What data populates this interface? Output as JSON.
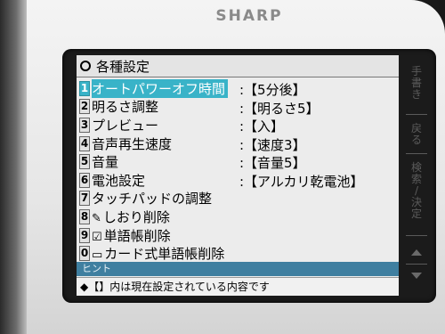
{
  "device": {
    "brand": "SHARP"
  },
  "screen": {
    "title": "各種設定",
    "items": [
      {
        "num": "1",
        "label": "オートパワーオフ時間",
        "value": ":【5分後】",
        "selected": true
      },
      {
        "num": "2",
        "label": "明るさ調整",
        "value": ":【明るさ5】"
      },
      {
        "num": "3",
        "label": "プレビュー",
        "value": ":【入】"
      },
      {
        "num": "4",
        "label": "音声再生速度",
        "value": ":【速度3】"
      },
      {
        "num": "5",
        "label": "音量",
        "value": ":【音量5】"
      },
      {
        "num": "6",
        "label": "電池設定",
        "value": ":【アルカリ乾電池】"
      },
      {
        "num": "7",
        "label": "タッチパッドの調整",
        "value": ""
      },
      {
        "num": "8",
        "icon": "pen-icon",
        "label": "しおり削除",
        "value": ""
      },
      {
        "num": "9",
        "icon": "card-check-icon",
        "label": "単語帳削除",
        "value": ""
      },
      {
        "num": "0",
        "icon": "card-icon",
        "label": "カード式単語帳削除",
        "value": ""
      }
    ],
    "hint_label": "ヒント",
    "hint_text": "◆【】内は現在設定されている内容です"
  },
  "side_keys": [
    {
      "label": "手\n書\nき"
    },
    {
      "label": "戻\nる"
    },
    {
      "label": "検\n索\n/\n決\n定"
    }
  ]
}
